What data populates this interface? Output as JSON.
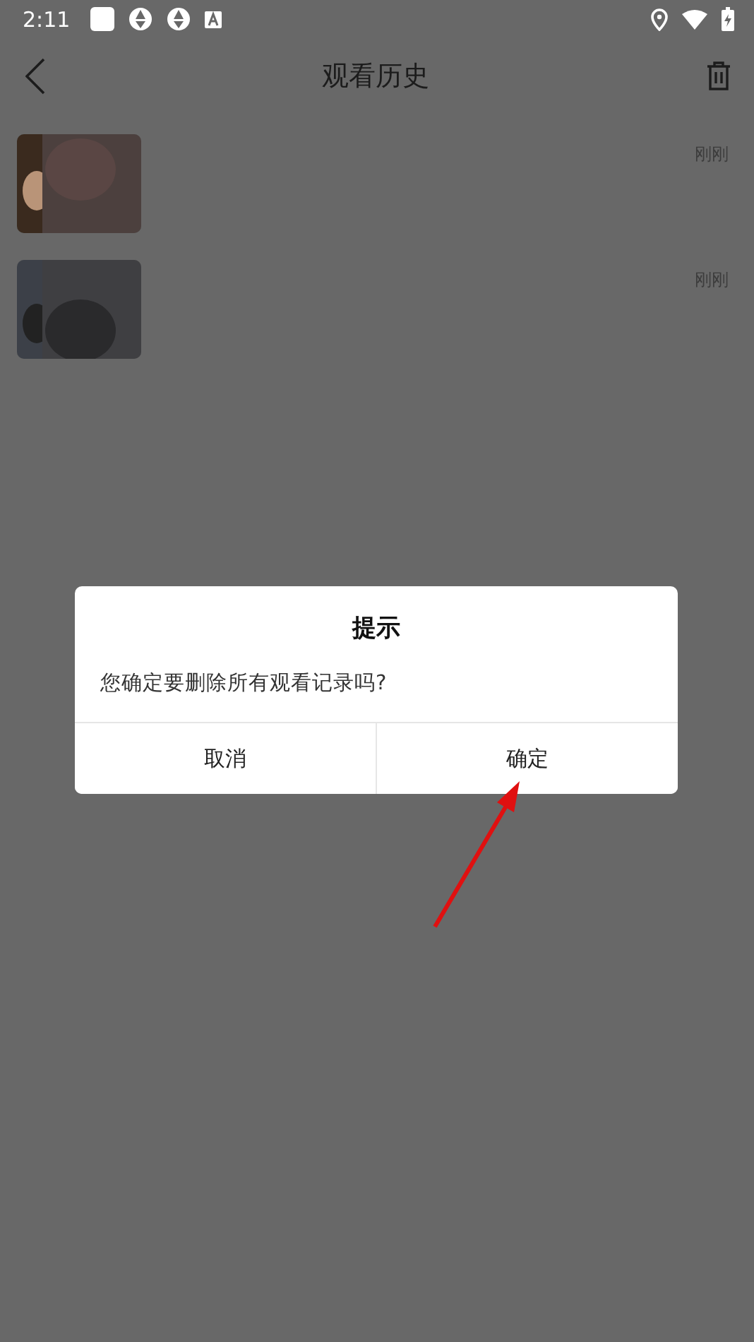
{
  "status_bar": {
    "time": "2:11"
  },
  "header": {
    "title": "观看历史"
  },
  "history": [
    {
      "time": "刚刚"
    },
    {
      "time": "刚刚"
    }
  ],
  "dialog": {
    "title": "提示",
    "message": "您确定要删除所有观看记录吗?",
    "buttons": [
      "取消",
      "确定"
    ]
  }
}
